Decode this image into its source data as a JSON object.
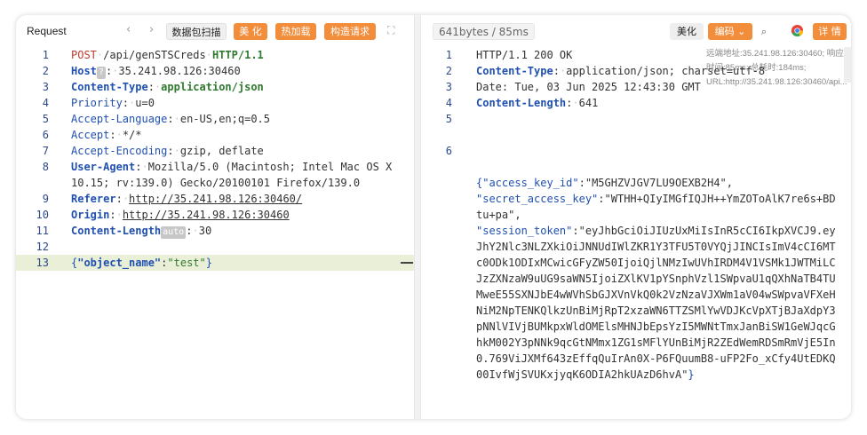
{
  "request": {
    "title": "Request",
    "nav_back": "‹",
    "nav_forward": "›",
    "buttons": {
      "capture": "数据包扫描",
      "beautify": "美 化",
      "hot_load": "热加载",
      "build_request": "构造请求"
    },
    "expand_icon": "expand-icon",
    "lines": {
      "n1": "1",
      "n2": "2",
      "n3": "3",
      "n4": "4",
      "n5": "5",
      "n6": "6",
      "n7": "7",
      "n8": "8",
      "n9": "9",
      "n10": "10",
      "n11": "11",
      "n12": "12",
      "n13": "13",
      "method": "POST",
      "path": "/api/genSTSCreds",
      "proto": "HTTP/1.1",
      "host_key": "Host",
      "host_badge": "?",
      "host_val": "35.241.98.126:30460",
      "ct_key": "Content-Type",
      "ct_val": "application/json",
      "prio_key": "Priority",
      "prio_val": "u=0",
      "al_key": "Accept-Language",
      "al_val": "en-US,en;q=0.5",
      "acc_key": "Accept",
      "acc_val": "*/*",
      "ae_key": "Accept-Encoding",
      "ae_val": "gzip, deflate",
      "ua_key": "User-Agent",
      "ua_val1": "Mozilla/5.0 (Macintosh; Intel Mac OS X",
      "ua_val2": "10.15; rv:139.0) Gecko/20100101 Firefox/139.0",
      "ref_key": "Referer",
      "ref_val": "http://35.241.98.126:30460/",
      "origin_key": "Origin",
      "origin_val": "http://35.241.98.126:30460",
      "cl_key": "Content-Length",
      "cl_badge": "auto",
      "cl_val": "30",
      "body_open": "{",
      "body_key": "\"object_name\"",
      "body_colon": ":",
      "body_val": "\"test\"",
      "body_close": "}"
    }
  },
  "response": {
    "size_info": "641bytes / 85ms",
    "beautify": "美化",
    "encoding": "编码",
    "details": "详 情",
    "remote": "远端地址:35.241.98.126:30460; 响应时间:85ms; 总耗时:184ms; URL:http://35.241.98.126:30460/api...",
    "lines": {
      "n1": "1",
      "n2": "2",
      "n3": "3",
      "n4": "4",
      "n5": "5",
      "n6": "6",
      "status": "HTTP/1.1 200 OK",
      "ct_key": "Content-Type",
      "ct_val": "application/json; charset=utf-8",
      "date": "Date: Tue, 03 Jun 2025 12:43:30 GMT",
      "cl_key": "Content-Length",
      "cl_val": "641",
      "open": "{",
      "k1": "\"access_key_id\"",
      "v1": "\"M5GHZVJGV7LU9OEXB2H4\"",
      "k2": "\"secret_access_key\"",
      "v2": "\"WTHH+QIyIMGfIQJH++YmZOToAlK7re6s+BDtu+pa\"",
      "k3": "\"session_token\"",
      "v3": "\"eyJhbGciOiJIUzUxMiIsInR5cCI6IkpXVCJ9.eyJhY2Nlc3NLZXkiOiJNNUdIWlZKR1Y3TFU5T0VYQjJINCIsImV4cCI6MTc0ODk1ODIxMCwicGFyZW50IjoiQjlNMzIwUVhIRDM4V1VSMk1JWTMiLCJzZXNzaW9uUG9saWN5IjoiZXlKV1pYSnphVzl1SWpvaU1qQXhNaTB4TUMweE55SXNJbE4wWVhSbGJXVnVkQ0k2VzNzaVJXWm1aV04wSWpvaVFXeHNiM2NpTENKQlkzUnBiMjRpT2xzaWN6TTZSMlYwVDJKcVpXTjBJaXdpY3pNNlVIVjBUMkpxWldOMElsMHNJbEpsYzI5MWNtTmxJanBiSW1GeWJqcGhkM002Y3pNNk9qcGtNMmx1ZG1sMFlYUnBiMjR2ZEdWemRDSmRmVjE5In0.769ViJXMf643zEffqQuIrAn0X-P6FQuumB8-uFP2Fo_xCfy4UtEDKQ00IvfWjSVUKxjyqK6ODIA2hkUAzD6hvA\"",
      "close": "}"
    }
  }
}
